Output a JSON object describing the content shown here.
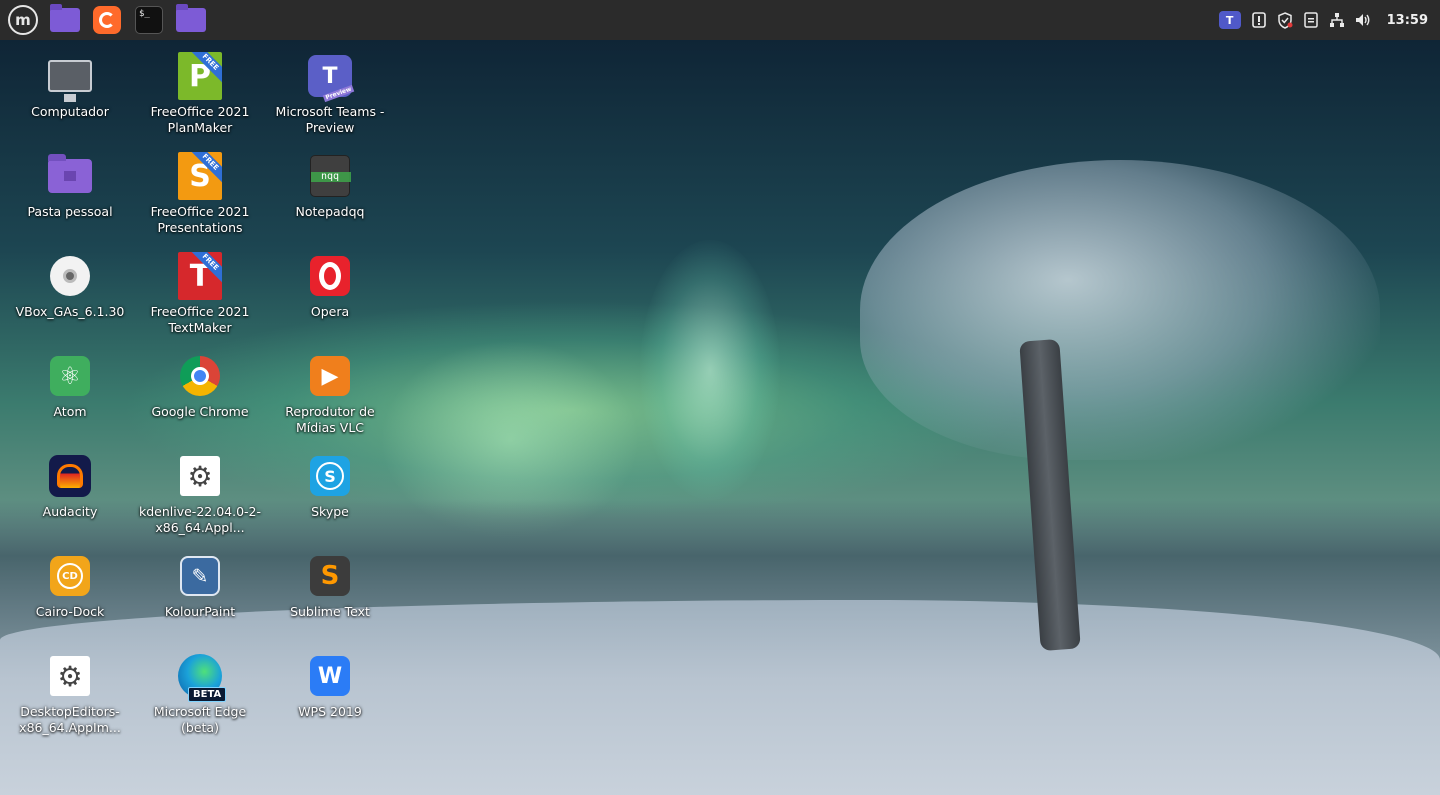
{
  "panel": {
    "launchers": [
      {
        "name": "mint-menu",
        "glyph": "m"
      },
      {
        "name": "file-manager",
        "glyph": ""
      },
      {
        "name": "firefox",
        "glyph": ""
      },
      {
        "name": "terminal",
        "glyph": "$_"
      },
      {
        "name": "folder",
        "glyph": ""
      }
    ],
    "tray": {
      "teams_glyph": "T",
      "clock": "13:59"
    }
  },
  "desktop": {
    "icons": [
      {
        "label": "Computador",
        "icon": "computer-icon"
      },
      {
        "label": "Pasta pessoal",
        "icon": "home-folder-icon"
      },
      {
        "label": "VBox_GAs_6.1.30",
        "icon": "disc-icon"
      },
      {
        "label": "Atom",
        "icon": "atom-icon",
        "glyph": "⚛"
      },
      {
        "label": "Audacity",
        "icon": "audacity-icon"
      },
      {
        "label": "Cairo-Dock",
        "icon": "cairo-dock-icon",
        "glyph": "CD"
      },
      {
        "label": "DesktopEditors-x86_64.AppIm...",
        "icon": "appimage-gear-icon",
        "glyph": "⚙"
      },
      {
        "label": "FreeOffice 2021 PlanMaker",
        "icon": "planmaker-icon",
        "glyph": "P",
        "badge": "FREE"
      },
      {
        "label": "FreeOffice 2021 Presentations",
        "icon": "presentations-icon",
        "glyph": "S",
        "badge": "FREE"
      },
      {
        "label": "FreeOffice 2021 TextMaker",
        "icon": "textmaker-icon",
        "glyph": "T",
        "badge": "FREE"
      },
      {
        "label": "Google Chrome",
        "icon": "chrome-icon"
      },
      {
        "label": "kdenlive-22.04.0-2-x86_64.Appl...",
        "icon": "appimage-gear-icon",
        "glyph": "⚙"
      },
      {
        "label": "KolourPaint",
        "icon": "kolourpaint-icon",
        "glyph": "✎"
      },
      {
        "label": "Microsoft Edge (beta)",
        "icon": "edge-icon",
        "badge": "BETA"
      },
      {
        "label": "Microsoft Teams - Preview",
        "icon": "teams-icon",
        "glyph": "T",
        "badge": "Preview"
      },
      {
        "label": "Notepadqq",
        "icon": "notepadqq-icon",
        "glyph": "nqq"
      },
      {
        "label": "Opera",
        "icon": "opera-icon"
      },
      {
        "label": "Reprodutor de Mídias VLC",
        "icon": "vlc-icon",
        "glyph": "▶"
      },
      {
        "label": "Skype",
        "icon": "skype-icon",
        "glyph": "S"
      },
      {
        "label": "Sublime Text",
        "icon": "sublime-icon",
        "glyph": "S"
      },
      {
        "label": "WPS 2019",
        "icon": "wps-icon",
        "glyph": "W"
      }
    ]
  }
}
